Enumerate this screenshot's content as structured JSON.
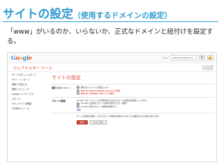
{
  "slide": {
    "title": "サイトの設定",
    "title_sub": "（使用するドメインの設定）",
    "description": "「www」がいるのか、いらないか、正式なドメインと紐付けを設定する。"
  },
  "app": {
    "product_name": "ウェブマスター ツール",
    "topbar_text": "ヘルプ",
    "account_text": "user@example.com",
    "help_button": "ヘルプ"
  },
  "sidebar": {
    "items": [
      {
        "label": "サイトのダッシュボード",
        "active": false
      },
      {
        "label": "サイト メッセージ",
        "active": false
      },
      {
        "label": "検索での見え方",
        "active": false
      },
      {
        "label": "検索トラフィック",
        "active": false
      },
      {
        "label": "Google インデックス",
        "active": false
      },
      {
        "label": "クロール",
        "active": false
      },
      {
        "label": "セキュリティの問題",
        "active": false
      },
      {
        "label": "その他のリソース",
        "active": false
      }
    ]
  },
  "main": {
    "heading": "サイトの設定",
    "rows": [
      {
        "label": "優先するドメイン",
        "lines": [
          {
            "type": "radio",
            "checked": true,
            "text": "優先するドメインを設定しない",
            "highlight": false
          },
          {
            "type": "radio",
            "checked": false,
            "text": "URL を www.example.com として表示",
            "highlight": true
          },
          {
            "type": "radio",
            "checked": false,
            "text": "URL を example.com として表示",
            "highlight": true
          }
        ]
      },
      {
        "label": "クロール頻度",
        "lines": [
          {
            "type": "text",
            "text": "Google では、サイトへの負荷を抑えながらクロール速度を最適化しています。",
            "link": false
          },
          {
            "type": "radio",
            "checked": true,
            "text": "Google に最適なクロール速度を決定させる（推奨）",
            "highlight": false
          },
          {
            "type": "radio",
            "checked": false,
            "text": "Google の最大クロール頻度を制限する",
            "highlight": false
          },
          {
            "type": "text",
            "text": "詳細",
            "link": true
          }
        ]
      }
    ],
    "note": "サイトの設定を保存してからクロール頻度が反映されるまでには数日かかる場合があります。",
    "buttons": {
      "save": "保存",
      "cancel": "キャンセル"
    }
  },
  "colors": {
    "accent": "#2e9ad0",
    "brand_red": "#dd4b39",
    "highlight": "#dd2e2e"
  }
}
